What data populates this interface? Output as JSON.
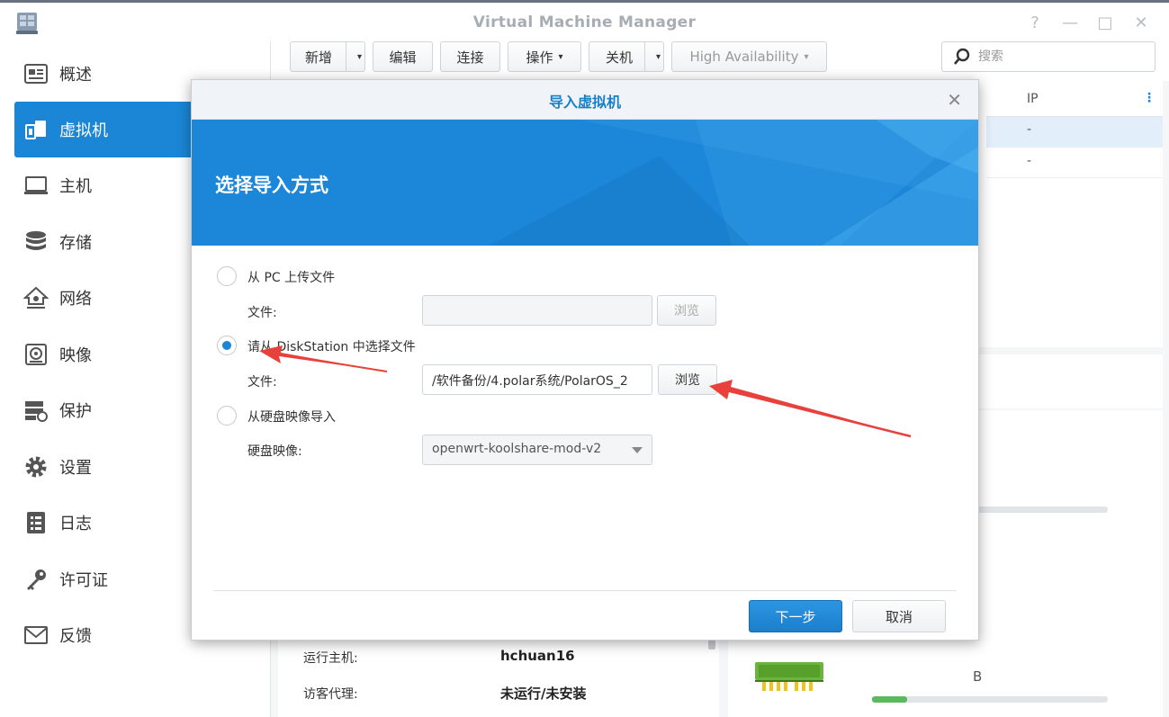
{
  "window": {
    "title": "Virtual Machine Manager",
    "controls": [
      "?",
      "—",
      "□",
      "✕"
    ]
  },
  "sidebar": {
    "items": [
      {
        "label": "概述",
        "icon": "overview-icon"
      },
      {
        "label": "虚拟机",
        "icon": "virtual-machine-icon",
        "active": true
      },
      {
        "label": "主机",
        "icon": "host-icon"
      },
      {
        "label": "存储",
        "icon": "storage-icon"
      },
      {
        "label": "网络",
        "icon": "network-icon"
      },
      {
        "label": "映像",
        "icon": "image-icon"
      },
      {
        "label": "保护",
        "icon": "protection-icon"
      },
      {
        "label": "设置",
        "icon": "settings-icon"
      },
      {
        "label": "日志",
        "icon": "log-icon"
      },
      {
        "label": "许可证",
        "icon": "license-icon"
      },
      {
        "label": "反馈",
        "icon": "feedback-icon"
      }
    ]
  },
  "toolbar": {
    "add_label": "新增",
    "edit_label": "编辑",
    "connect_label": "连接",
    "action_label": "操作",
    "shutdown_label": "关机",
    "ha_label": "High Availability",
    "search_placeholder": "搜索"
  },
  "vm_list": {
    "ip_header": "IP",
    "rows": [
      {
        "ip": "-"
      },
      {
        "ip": "-"
      }
    ]
  },
  "details": {
    "host_label": "运行主机:",
    "host_value": "hchuan16",
    "guest_label": "访客代理:",
    "guest_value": "未运行/未安装",
    "partial_unit": "B",
    "usage_fraction": 0.15
  },
  "dialog": {
    "title": "导入虚拟机",
    "banner_title": "选择导入方式",
    "option_pc": "从 PC 上传文件",
    "option_diskstation": "请从 DiskStation 中选择文件",
    "option_disk_image": "从硬盘映像导入",
    "file_label": "文件:",
    "browse_label": "浏览",
    "pc_file_value": "",
    "diskstation_file_value": "/软件备份/4.polar系统/PolarOS_2",
    "disk_image_label": "硬盘映像:",
    "disk_image_value": "openwrt-koolshare-mod-v2",
    "next_label": "下一步",
    "cancel_label": "取消"
  },
  "colors": {
    "accent": "#1b86d6",
    "annotation_arrow": "#e8413c"
  }
}
